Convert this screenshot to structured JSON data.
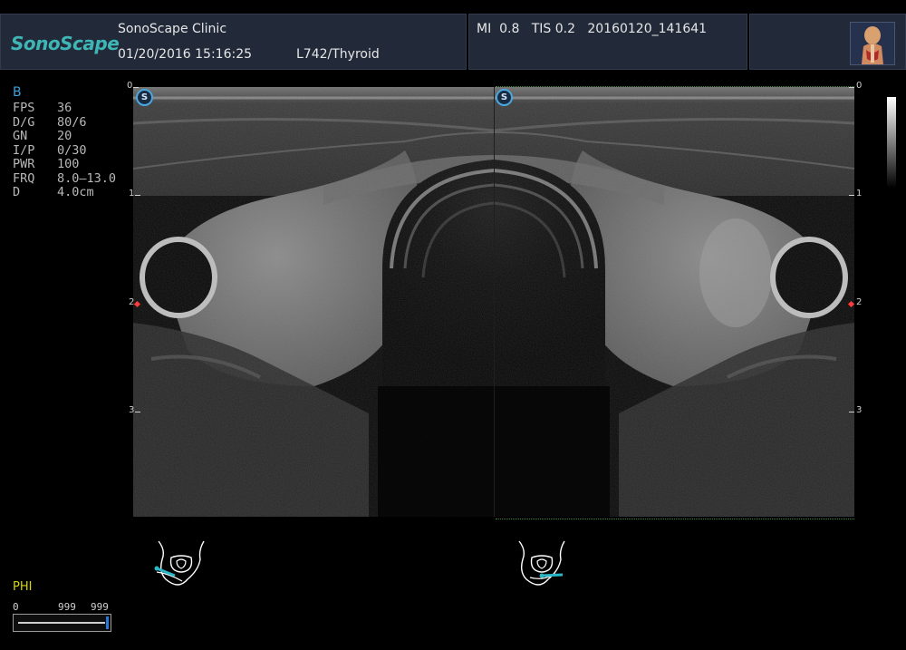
{
  "header": {
    "logo_text": "SonoScape",
    "clinic_name": "SonoScape Clinic",
    "datetime": "01/20/2016 15:16:25",
    "probe_preset": "L742/Thyroid",
    "indices": "MI  0.8   TIS 0.2   20160120_141641",
    "patient_icon": "thyroid-anatomy-icon"
  },
  "mode": "B",
  "params": [
    {
      "key": "FPS",
      "value": "36"
    },
    {
      "key": "D/G",
      "value": "80/6"
    },
    {
      "key": "GN",
      "value": "20"
    },
    {
      "key": "I/P",
      "value": "0/30"
    },
    {
      "key": "PWR",
      "value": "100"
    },
    {
      "key": "FRQ",
      "value": "8.0–13.0"
    },
    {
      "key": "D",
      "value": "4.0cm"
    }
  ],
  "phi_label": "PHI",
  "phi_bar": {
    "min_label": "0",
    "mid_label": "999",
    "max_label": "999"
  },
  "depth_labels": [
    "0",
    "1",
    "2",
    "3"
  ],
  "panels": {
    "left": {
      "badge": "S"
    },
    "right": {
      "badge": "S"
    }
  },
  "colors": {
    "header_bg": "#222a3a",
    "logo": "#3fb6b6",
    "mode": "#3aa0e0",
    "phi": "#d6d600",
    "probe_marker": "#2ab7c8",
    "focus_marker": "#ff3a3a"
  }
}
